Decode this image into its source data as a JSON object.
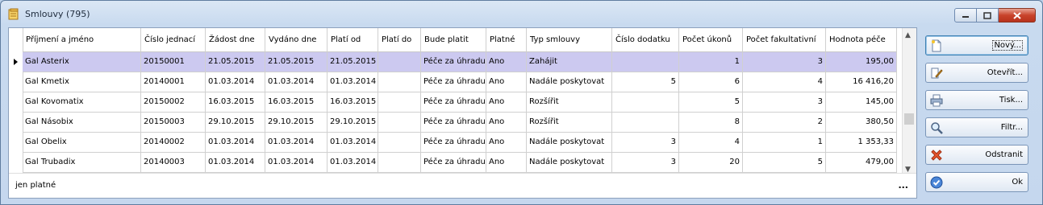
{
  "window": {
    "title": "Smlouvy (795)"
  },
  "grid": {
    "columns": [
      "Příjmení a jméno",
      "Číslo jednací",
      "Žádost dne",
      "Vydáno dne",
      "Platí od",
      "Platí do",
      "Bude platit",
      "Platné",
      "Typ smlouvy",
      "Číslo dodatku",
      "Počet úkonů",
      "Počet fakultativní",
      "Hodnota péče"
    ],
    "rows": [
      [
        "Gal Asterix",
        "20150001",
        "21.05.2015",
        "21.05.2015",
        "21.05.2015",
        "",
        "Péče za úhradu",
        "Ano",
        "Zahájit",
        "",
        "1",
        "3",
        "195,00"
      ],
      [
        "Gal Kmetix",
        "20140001",
        "01.03.2014",
        "01.03.2014",
        "01.03.2014",
        "",
        "Péče za úhradu",
        "Ano",
        "Nadále poskytovat",
        "5",
        "6",
        "4",
        "16 416,20"
      ],
      [
        "Gal Kovomatix",
        "20150002",
        "16.03.2015",
        "16.03.2015",
        "16.03.2015",
        "",
        "Péče za úhradu",
        "Ano",
        "Rozšířit",
        "",
        "5",
        "3",
        "145,00"
      ],
      [
        "Gal Násobix",
        "20150003",
        "29.10.2015",
        "29.10.2015",
        "29.10.2015",
        "",
        "Péče za úhradu",
        "Ano",
        "Rozšířit",
        "",
        "8",
        "2",
        "380,50"
      ],
      [
        "Gal Obelix",
        "20140002",
        "01.03.2014",
        "01.03.2014",
        "01.03.2014",
        "",
        "Péče za úhradu",
        "Ano",
        "Nadále poskytovat",
        "3",
        "4",
        "1",
        "1 353,33"
      ],
      [
        "Gal Trubadix",
        "20140003",
        "01.03.2014",
        "01.03.2014",
        "01.03.2014",
        "",
        "Péče za úhradu",
        "Ano",
        "Nadále poskytovat",
        "3",
        "20",
        "5",
        "479,00"
      ]
    ]
  },
  "footer": {
    "filter_label": "jen platné",
    "ellipsis": "..."
  },
  "buttons": {
    "new": "Nový...",
    "open": "Otevřít...",
    "print": "Tisk...",
    "filter": "Filtr...",
    "delete": "Odstranit",
    "ok": "Ok"
  }
}
